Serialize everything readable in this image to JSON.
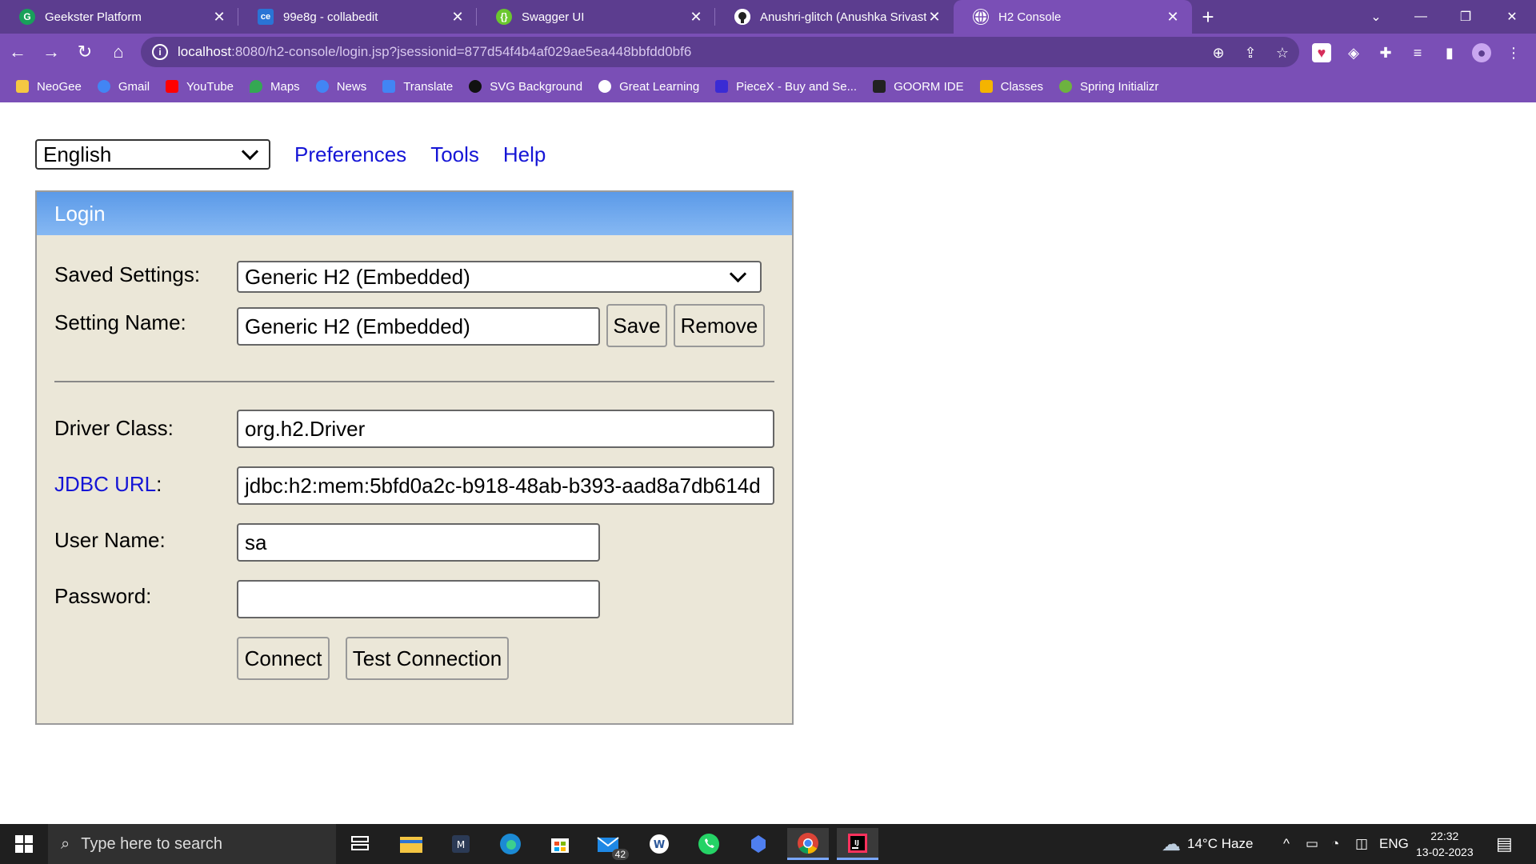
{
  "browser": {
    "tabs": [
      {
        "title": "Geekster Platform",
        "favicon": "geekster-icon",
        "color": "#19a05a"
      },
      {
        "title": "99e8g - collabedit",
        "favicon": "collabedit-icon",
        "color": "#2a74d5"
      },
      {
        "title": "Swagger UI",
        "favicon": "swagger-icon",
        "color": "#6bc72f"
      },
      {
        "title": "Anushri-glitch (Anushka Srivastav",
        "favicon": "github-icon",
        "color": "#ffffff"
      },
      {
        "title": "H2 Console",
        "favicon": "globe-icon",
        "color": "#ffffff",
        "active": true
      }
    ],
    "url_host": "localhost",
    "url_path": ":8080/h2-console/login.jsp?jsessionid=877d54f4b4af029ae5ea448bbfdd0bf6",
    "bookmarks": [
      {
        "label": "NeoGee",
        "icon": "folder-icon",
        "color": "#f5c842"
      },
      {
        "label": "Gmail",
        "icon": "gmail-icon",
        "color": "#4285f4"
      },
      {
        "label": "YouTube",
        "icon": "youtube-icon",
        "color": "#ff0000"
      },
      {
        "label": "Maps",
        "icon": "maps-icon",
        "color": "#34a853"
      },
      {
        "label": "News",
        "icon": "news-icon",
        "color": "#4285f4"
      },
      {
        "label": "Translate",
        "icon": "translate-icon",
        "color": "#4285f4"
      },
      {
        "label": "SVG Background",
        "icon": "svg-background-icon",
        "color": "#111111"
      },
      {
        "label": "Great Learning",
        "icon": "great-learning-icon",
        "color": "#ffffff"
      },
      {
        "label": "PieceX - Buy and Se...",
        "icon": "piecex-icon",
        "color": "#3a2bd4"
      },
      {
        "label": "GOORM IDE",
        "icon": "goorm-icon",
        "color": "#222222"
      },
      {
        "label": "Classes",
        "icon": "classroom-icon",
        "color": "#f4b400"
      },
      {
        "label": "Spring Initializr",
        "icon": "spring-icon",
        "color": "#6db33f"
      }
    ]
  },
  "topbar": {
    "language": "English",
    "links": [
      "Preferences",
      "Tools",
      "Help"
    ]
  },
  "login": {
    "header": "Login",
    "saved_settings_label": "Saved Settings:",
    "saved_settings_value": "Generic H2 (Embedded)",
    "setting_name_label": "Setting Name:",
    "setting_name_value": "Generic H2 (Embedded)",
    "save_button": "Save",
    "remove_button": "Remove",
    "driver_class_label": "Driver Class:",
    "driver_class_value": "org.h2.Driver",
    "jdbc_url_label": "JDBC URL",
    "jdbc_url_colon": ":",
    "jdbc_url_value": "jdbc:h2:mem:5bfd0a2c-b918-48ab-b393-aad8a7db614d",
    "user_name_label": "User Name:",
    "user_name_value": "sa",
    "password_label": "Password:",
    "password_value": "",
    "connect_button": "Connect",
    "test_connection_button": "Test Connection"
  },
  "taskbar": {
    "search_placeholder": "Type here to search",
    "mail_badge": "42",
    "weather": "14°C  Haze",
    "language": "ENG",
    "time": "22:32",
    "date": "13-02-2023"
  }
}
